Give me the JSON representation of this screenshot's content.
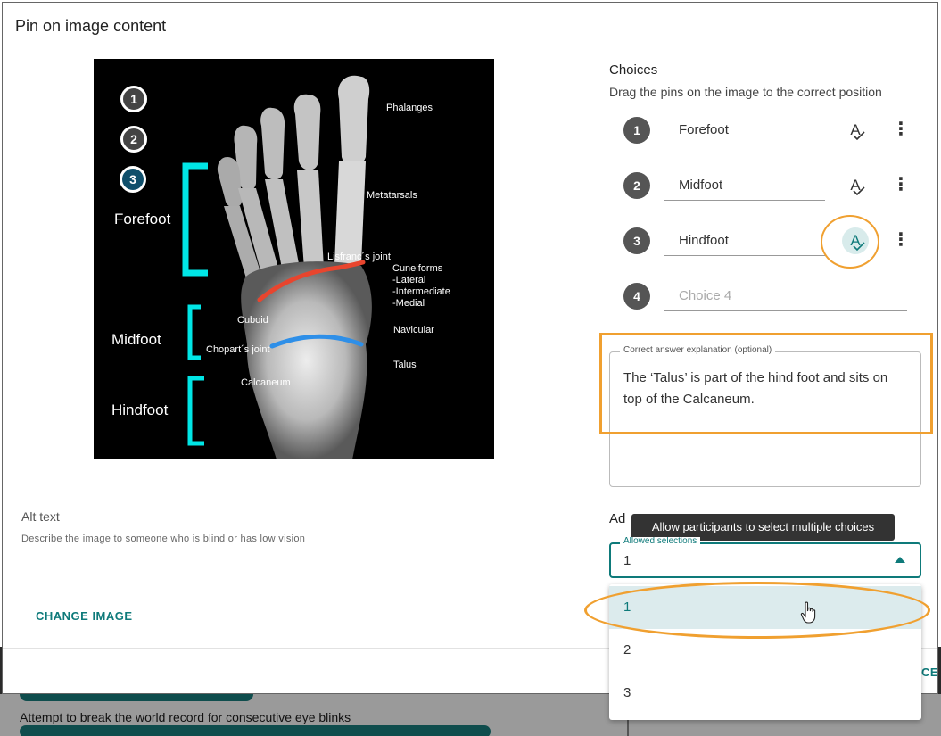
{
  "background": {
    "item_text": "Attempt to break the world record for consecutive eye blinks"
  },
  "modal": {
    "title": "Pin on image content",
    "cancel_partial": "CE"
  },
  "image": {
    "bone_labels": [
      "Phalanges",
      "Metatarsals",
      "Lisfranc´s joint",
      "Cuneiforms",
      "-Lateral",
      "-Intermediate",
      "-Medial",
      "Cuboid",
      "Chopart´s joint",
      "Navicular",
      "Talus",
      "Calcaneum"
    ],
    "section_labels": [
      "Forefoot",
      "Midfoot",
      "Hindfoot"
    ],
    "pins": [
      "1",
      "2",
      "3"
    ],
    "active_pin": "3",
    "colors": {
      "bracket": "#00e6e6",
      "lisfranc_line": "#e8452e",
      "chopart_line": "#2e8fe8"
    }
  },
  "alt_text": {
    "label": "Alt text",
    "help": "Describe the image to someone who is blind or has low vision"
  },
  "change_image_label": "CHANGE IMAGE",
  "choices": {
    "title": "Choices",
    "subtitle": "Drag the pins on the image to the correct position",
    "items": [
      {
        "number": "1",
        "value": "Forefoot",
        "placeholder": ""
      },
      {
        "number": "2",
        "value": "Midfoot",
        "placeholder": ""
      },
      {
        "number": "3",
        "value": "Hindfoot",
        "placeholder": ""
      },
      {
        "number": "4",
        "value": "",
        "placeholder": "Choice 4"
      }
    ],
    "spellcheck_icon": "A",
    "more_icon": "⋮"
  },
  "explanation": {
    "legend": "Correct answer explanation (optional)",
    "text": "The ‘Talus’ is part of the hind foot and sits on top of the Calcaneum."
  },
  "advanced": {
    "label": "Ad",
    "tooltip": "Allow participants to select multiple choices",
    "select_legend": "Allowed selections",
    "selected_value": "1",
    "options": [
      "1",
      "2",
      "3"
    ]
  },
  "accent_color": "#0e7a7a",
  "highlight_color": "#f0a030"
}
